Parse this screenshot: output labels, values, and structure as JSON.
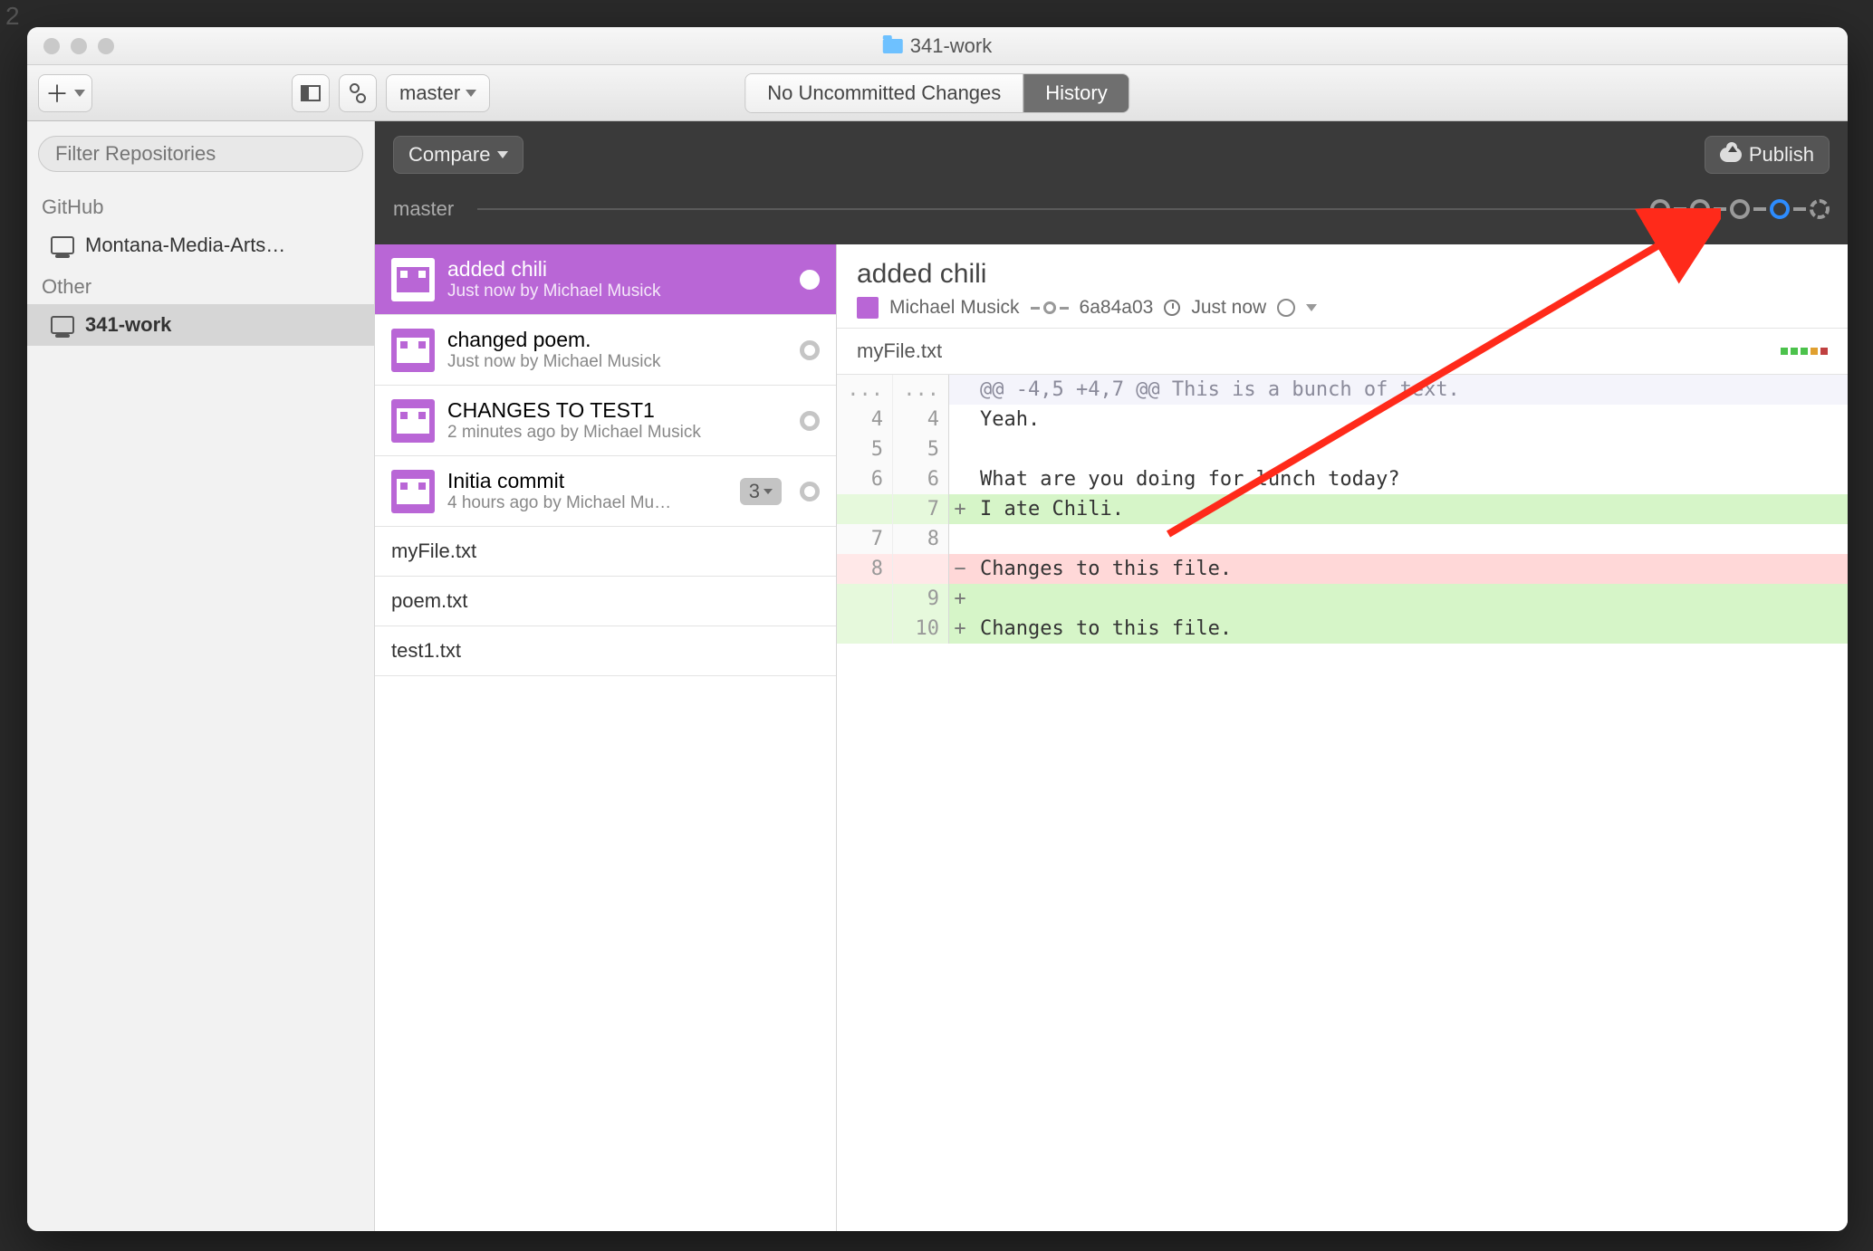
{
  "background": {
    "lineNumber": "2"
  },
  "window": {
    "title": "341-work"
  },
  "toolbar": {
    "branch": "master",
    "tabs": [
      "No Uncommitted Changes",
      "History"
    ]
  },
  "sidebar": {
    "filterPlaceholder": "Filter Repositories",
    "sections": [
      {
        "label": "GitHub",
        "items": [
          "Montana-Media-Arts…"
        ]
      },
      {
        "label": "Other",
        "items": [
          "341-work"
        ]
      }
    ]
  },
  "history": {
    "compareLabel": "Compare",
    "publishLabel": "Publish",
    "timelineBranch": "master"
  },
  "commits": [
    {
      "title": "added chili",
      "sub": "Just now by Michael Musick"
    },
    {
      "title": "changed poem.",
      "sub": "Just now by Michael Musick"
    },
    {
      "title": "CHANGES TO TEST1",
      "sub": "2 minutes ago by Michael Musick"
    },
    {
      "title": "Initia commit",
      "sub": "4 hours ago by Michael Mu…",
      "badge": "3"
    }
  ],
  "changedFiles": [
    "myFile.txt",
    "poem.txt",
    "test1.txt"
  ],
  "detail": {
    "title": "added chili",
    "author": "Michael Musick",
    "sha": "6a84a03",
    "time": "Just now",
    "file": "myFile.txt"
  },
  "diff": [
    {
      "old": "...",
      "new": "...",
      "m": " ",
      "text": "@@ -4,5 +4,7 @@ This is a bunch of text."
    },
    {
      "old": "4",
      "new": "4",
      "m": " ",
      "text": "Yeah."
    },
    {
      "old": "5",
      "new": "5",
      "m": " ",
      "text": ""
    },
    {
      "old": "6",
      "new": "6",
      "m": " ",
      "text": "What are you doing for lunch today?"
    },
    {
      "old": "",
      "new": "7",
      "m": "+",
      "text": "I ate Chili."
    },
    {
      "old": "7",
      "new": "8",
      "m": " ",
      "text": ""
    },
    {
      "old": "8",
      "new": "",
      "m": "−",
      "text": "Changes to this file."
    },
    {
      "old": "",
      "new": "9",
      "m": "+",
      "text": ""
    },
    {
      "old": "",
      "new": "10",
      "m": "+",
      "text": "Changes to this file."
    }
  ]
}
